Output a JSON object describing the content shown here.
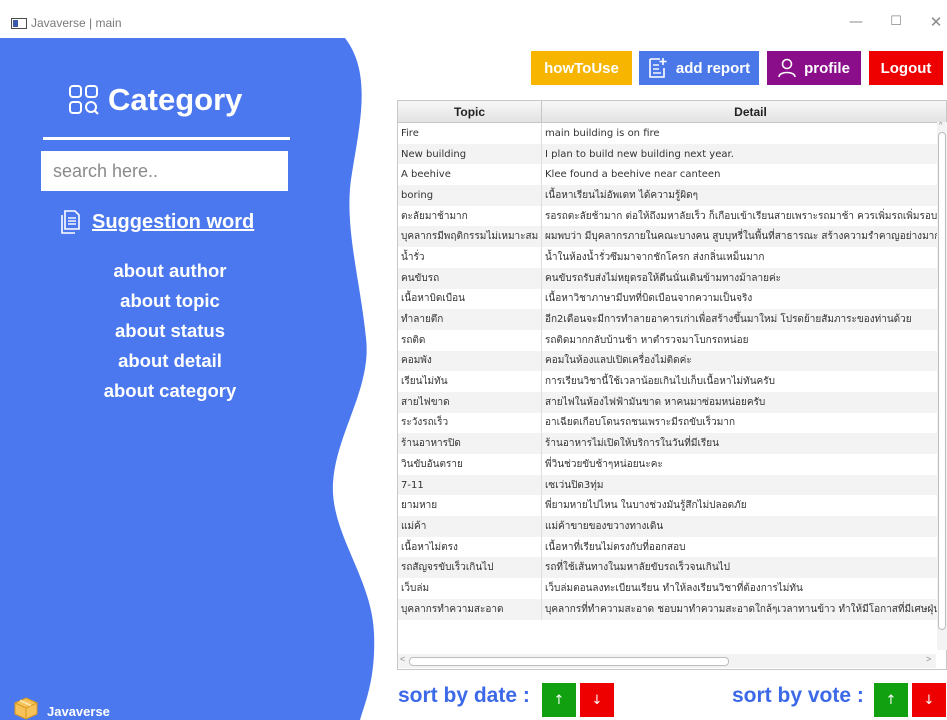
{
  "window": {
    "title": "Javaverse | main",
    "minimize": "—",
    "maximize": "☐",
    "close": "✕"
  },
  "sidebar": {
    "heading": "Category",
    "search_placeholder": "search here..",
    "suggestion_label": "Suggestion word",
    "about_items": [
      "about author",
      "about topic",
      "about status",
      "about detail",
      "about category"
    ],
    "brand_name": "Javaverse",
    "background_color": "#4b78ee"
  },
  "top_buttons": {
    "how_to_use": "howToUse",
    "add_report": "add report",
    "profile": "profile",
    "logout": "Logout"
  },
  "table": {
    "columns": [
      "Topic",
      "Detail"
    ],
    "rows": [
      [
        "Fire",
        "main building is on fire"
      ],
      [
        "New building",
        "I plan to build new building next year."
      ],
      [
        "A beehive",
        "Klee found a beehive near canteen"
      ],
      [
        "boring",
        "เนื้อหาเรียนไม่อัพเดท ได้ความรู้ผิดๆ"
      ],
      [
        "ตะลัยมาช้ามาก",
        "รอรถตะลัยช้ามาก ต่อให้ถึงมหาลัยเร็ว ก็เกือบเข้าเรียนสายเพราะรถมาช้า ควรเพิ่มรถเพิ่มรอบ"
      ],
      [
        "บุคลากรมีพฤติกรรมไม่เหมาะสม",
        "ผมพบว่า มีบุคลากรภายในคณะบางคน สูบบุหรี่ในพื้นที่สาธารณะ สร้างความรำคาญอย่างมากครับ"
      ],
      [
        "น้ำรั่ว",
        "น้ำในห้องน้ำรั่วซึมมาจากชักโครก ส่งกลิ่นเหม็นมาก"
      ],
      [
        "คนขับรถ",
        "คนขับรถรับส่งไม่หยุดรอให้ดีนนั่นเดินข้ามทางม้าลายค่ะ"
      ],
      [
        "เนื้อหาบิดเบือน",
        "เนื้อหาวิชาภาษามีบทที่บิดเบือนจากความเป็นจริง"
      ],
      [
        "ทำลายตึก",
        "อีก2เดือนจะมีการทำลายอาคารเก่าเพื่อสร้างขึ้นมาใหม่ โปรดย้ายสัมภาระของท่านด้วย"
      ],
      [
        "รถติด",
        "รถติดมากกลับบ้านช้า หาตำรวจมาโบกรถหน่อย"
      ],
      [
        "คอมพัง",
        "คอมในห้องแลปเปิดเครื่องไม่ติดค่ะ"
      ],
      [
        "เรียนไม่ทัน",
        "การเรียนวิชานี้ใช้เวลาน้อยเกินไปเก็บเนื้อหาไม่ทันครับ"
      ],
      [
        "สายไฟขาด",
        "สายไฟในห้องไฟฟ้ามันขาด หาคนมาซ่อมหน่อยครับ"
      ],
      [
        "ระวังรถเร็ว",
        "อาเฉียดเกือบโดนรถชนเพราะมีรถขับเร็วมาก"
      ],
      [
        "ร้านอาหารปิด",
        "ร้านอาหารไม่เปิดให้บริการในวันที่มีเรียน"
      ],
      [
        "วินขับอันตราย",
        "พี่วินช่วยขับช้าๆหน่อยนะคะ"
      ],
      [
        "7-11",
        "เซเว่นปิด3ทุ่ม"
      ],
      [
        "ยามหาย",
        "พี่ยามหายไปไหน ในบางช่วงมันรู้สึกไม่ปลอดภัย"
      ],
      [
        "แม่ค้า",
        "แม่ค้าขายของขวางทางเดิน"
      ],
      [
        "เนื้อหาไม่ตรง",
        "เนื้อหาที่เรียนไม่ตรงกับที่ออกสอบ"
      ],
      [
        "รถสัญจรขับเร็วเกินไป",
        "รถที่ใช้เส้นทางในมหาลัยขับรถเร็วจนเกินไป"
      ],
      [
        "เว็บล่ม",
        "เว็บล่มตอนลงทะเบียนเรียน ทำให้ลงเรียนวิชาที่ต้องการไม่ทัน"
      ],
      [
        "บุคลากรทำความสะอาด",
        "บุคลากรที่ทำความสะอาด ชอบมาทำความสะอาดใกล้ๆเวลาทานข้าว ทำให้มีโอกาสที่มีเศษฝุ่นปนเปื้อน"
      ]
    ]
  },
  "sort": {
    "by_date": "sort by date :",
    "by_vote": "sort by vote :",
    "up": "↑",
    "down": "↓"
  },
  "colors": {
    "accent_blue": "#4b78ee",
    "how_to_use": "#f7b500",
    "add_report": "#4b78e8",
    "profile": "#8a0d8a",
    "logout": "#ee0000",
    "sort_up": "#10a010",
    "sort_down": "#ee0000"
  }
}
